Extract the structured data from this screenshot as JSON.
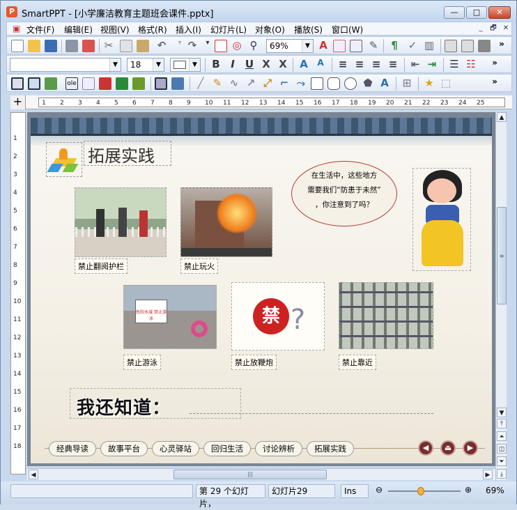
{
  "window": {
    "app_name": "SmartPPT",
    "title": "SmartPPT - [小学廉洁教育主题班会课件.pptx]",
    "app_icon_letter": "P"
  },
  "window_controls": {
    "minimize": "—",
    "maximize": "□",
    "close": "✕"
  },
  "menubar": {
    "items": [
      {
        "label": "文件(F)"
      },
      {
        "label": "编辑(E)"
      },
      {
        "label": "视图(V)"
      },
      {
        "label": "格式(R)"
      },
      {
        "label": "插入(I)"
      },
      {
        "label": "幻灯片(L)"
      },
      {
        "label": "对象(O)"
      },
      {
        "label": "播放(S)"
      },
      {
        "label": "窗口(W)"
      }
    ],
    "doc_controls": [
      "_",
      "🗗",
      "✕"
    ]
  },
  "toolbar1": {
    "zoom_value": "69%",
    "overflow": "»"
  },
  "toolbar2": {
    "font_name": "",
    "font_size": "18",
    "bold": "B",
    "italic": "I",
    "underline": "U",
    "strike": "X",
    "shadow": "X",
    "grow": "A",
    "shrink": "A",
    "overflow": "»"
  },
  "toolbar3": {
    "overflow": "»"
  },
  "ruler": {
    "h_ticks": [
      "1",
      "2",
      "3",
      "4",
      "5",
      "6",
      "7",
      "8",
      "9",
      "10",
      "11",
      "12",
      "13",
      "14",
      "15",
      "16",
      "17",
      "18",
      "19",
      "20",
      "21",
      "22",
      "23",
      "24",
      "25"
    ],
    "v_ticks": [
      "1",
      "2",
      "3",
      "4",
      "5",
      "6",
      "7",
      "8",
      "9",
      "10",
      "11",
      "12",
      "13",
      "14",
      "15",
      "16",
      "17",
      "18"
    ]
  },
  "slide": {
    "heading": "拓展实践",
    "bubble_lines": [
      "在生活中，这些地方",
      "需要我们“防患于未然”",
      "，你注意到了吗？"
    ],
    "captions": [
      "禁止翻阅护栏",
      "禁止玩火",
      "禁止游泳",
      "禁止放鞭炮",
      "禁止靠近"
    ],
    "forbid_sign": "禁",
    "pool_sign": "危险水域 禁止游泳",
    "know_text": "我还知道：",
    "nav_buttons": [
      "经典导读",
      "故事平台",
      "心灵驿站",
      "回归生活",
      "讨论辨析",
      "拓展实践"
    ],
    "round_buttons": [
      "◀",
      "⏏",
      "▶"
    ]
  },
  "statusbar": {
    "slide_info": "第 29 个幻灯片，",
    "slide_name": "幻灯片29",
    "mode": "Ins",
    "zoom": "69%"
  },
  "colors": {
    "roof": "#3e5771",
    "nav_round": "#7a2d2d",
    "bubble_border": "#b23a3a",
    "accent_close": "#c9432a"
  }
}
